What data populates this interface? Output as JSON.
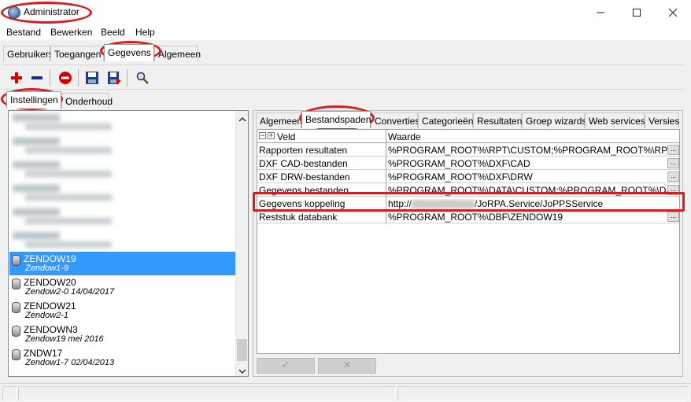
{
  "window": {
    "title": "Administrator"
  },
  "menu": [
    "Bestand",
    "Bewerken",
    "Beeld",
    "Help"
  ],
  "top_tabs": [
    "Gebruikers",
    "Toegangen",
    "Gegevens",
    "Algemeen"
  ],
  "top_tabs_active": "Gegevens",
  "toolbar": {
    "icons": [
      "add-icon",
      "remove-icon",
      "stop-icon",
      "save-icon",
      "save-as-icon",
      "search-icon"
    ]
  },
  "sub_tabs": [
    "Instellingen",
    "Onderhoud"
  ],
  "sub_tabs_active": "Instellingen",
  "databases": [
    {
      "name": "ZENDOW19",
      "desc": "Zendow1-9",
      "selected": true
    },
    {
      "name": "ZENDOW20",
      "desc": "Zendow2-0 14/04/2017"
    },
    {
      "name": "ZENDOW21",
      "desc": "Zendow2-1"
    },
    {
      "name": "ZENDOWN3",
      "desc": "Zendow19 mei 2016"
    },
    {
      "name": "ZNDW17",
      "desc": "Zendow1-7 02/04/2013"
    }
  ],
  "settings_tabs": [
    "Algemeen",
    "Bestandspaden",
    "Converties",
    "Categorieën",
    "Resultaten",
    "Groep wizards",
    "Web services",
    "Versies"
  ],
  "settings_tabs_active": "Bestandspaden",
  "grid": {
    "col_field": "Veld",
    "col_value": "Waarde",
    "rows": [
      {
        "field": "Rapporten resultaten",
        "value": "%PROGRAM_ROOT%\\RPT\\CUSTOM;%PROGRAM_ROOT%\\RPT\\PVC;%",
        "ellipsis": true
      },
      {
        "field": "DXF CAD-bestanden",
        "value": "%PROGRAM_ROOT%\\DXF\\CAD",
        "ellipsis": true
      },
      {
        "field": "DXF DRW-bestanden",
        "value": "%PROGRAM_ROOT%\\DXF\\DRW",
        "ellipsis": true
      },
      {
        "field": "Gegevens bestanden",
        "value": "%PROGRAM_ROOT%\\DATA\\CUSTOM;%PROGRAM_ROOT%\\DATA\\PV",
        "ellipsis": true
      },
      {
        "field": "Gegevens koppeling",
        "value_prefix": "http://",
        "value_suffix": "/JoRPA.Service/JoPPSService",
        "ellipsis": false
      },
      {
        "field": "Reststuk databank",
        "value": "%PROGRAM_ROOT%\\DBF\\ZENDOW19",
        "ellipsis": true
      }
    ]
  },
  "buttons": {
    "ok": "✓",
    "cancel": "✕"
  },
  "colors": {
    "annotation": "#d11f24",
    "selection": "#3399ff"
  }
}
